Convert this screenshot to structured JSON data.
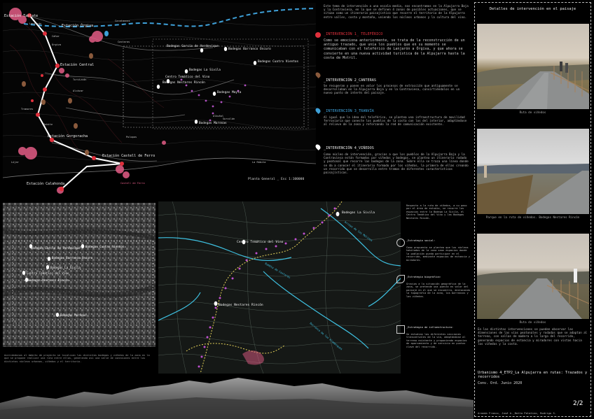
{
  "main_map": {
    "scale_label": "Planta General _ Esc 1:100000",
    "stations": [
      "Estación Tablate",
      "Estación Órgiva",
      "Estación Central",
      "Estación Gorgoracha",
      "Estación Castell de Ferro",
      "Estación Calahonda"
    ],
    "towns": [
      "Lanjarón",
      "Cáñar",
      "Órgiva",
      "Carataunas",
      "Castaras",
      "Torvizcón",
      "Alcázar",
      "Tramores",
      "Rubite",
      "Polopos",
      "Lújar",
      "La Rábita",
      "Castell de Ferro",
      "Sorvilán",
      "Albuñol"
    ],
    "wineries": [
      "Bodegas García de Verdevique",
      "Bodegas Barranco Oscuro",
      "Bodegas Cuatro Vientos",
      "Bodegas La Sivila",
      "Centro Temático del Vino",
      "Bodegas Nestares Rincón",
      "Bodegas Mayla",
      "Bodegas Marenas"
    ]
  },
  "center_text": {
    "intro": "Este tema de intervención a una escala media, nos encontramos en la Alpujarra Baja y la Contraviesa, en la que se definen 4 zonas de posibles actuaciones, que se sitúan como un itinerario paisajístico que recorre el territorio de la Alpujarra entre valles, costa y montaña, uniendo los núcleos urbanos y la cultura del vino.",
    "sections": [
      {
        "title": "_INTERVENCIÓN 1_ TELEFÉRICO",
        "color": "#e0303c",
        "icon": "red-dot",
        "text": "Como se emociona anteriormente, se trata de la reconstrucción de un antiguo trazado, que unía los pueblos que en su momento se comunicaban con el teleférico de Lanjarón a Órgiva, y que ahora se convierte en una nueva actividad turística de la Alpujarra hasta la costa de Motril."
      },
      {
        "title": "_INTERVENCIÓN 2_CANTERAS",
        "color": "#8a5a3c",
        "icon": "brown-pin",
        "text": "Se recuperan y ponen en valor los procesos de extracción que antiguamente se desarrollaban en la Alpujarra Baja y en la Contraviesa, convirtiéndolos en un nuevo punto de interés del paisaje."
      },
      {
        "title": "_INTERVENCIÓN 3_TRANVÍA",
        "color": "#3ea0d8",
        "icon": "blue-pin",
        "text": "Al igual que la idea del teleférico, se plantea una infraestructura de movilidad ferroviaria que conecte los pueblos de la costa con los del interior, adaptándose al relieve de la zona y reforzando la red de comunicación existente."
      },
      {
        "title": "_INTERVENCIÓN 4_VIÑEDOS",
        "color": "#ffffff",
        "icon": "white-pin",
        "text": "Como núcleo de intervención, gracias a que los pueblos de la Alpujarra Baja y la Contraviesa están formados por viñedos y bodegas, se plantea un itinerario rodado y peatonal que recorre las bodegas de la zona. Sobre ella se traza una línea donde se da a conocer el itinerario formado por los viñedos, la primera de ellas creando un recorrido que se desarrolla entre tramos de diferentes características paisajísticas."
      }
    ]
  },
  "right_panel": {
    "title": "Detalles de intervención en el paisaje",
    "captions": [
      "Ruta de viñedos",
      "Parque en la ruta de viñedos. Bodegas Nestares Rincón",
      "Ruta de viñedos"
    ],
    "footer_text": "En las distintas intervenciones se pueden observar las dimensiones de las vías peatonales y rodadas que se adaptan al terreno, con vallas de madera a lo largo del recorrido, generando espacios de estancia y miradores con vistas hacia los viñedos y la costa.",
    "project_title": "Urbanismo 4_ETP2_La Alpujarra en rutas: Trazados y recorridos",
    "convocatoria": "Conv. Ord. Junio 2020",
    "page": "2/2",
    "authors": "Aranda Franco, José A._Botta Palatino, Rodrigo S."
  },
  "bottom_left": {
    "caption": "Acercándonos al ámbito de proyecto se localizan las distintas bodegas y viñedos de la zona en la que se propone realizar una ruta entre ellas, generando así una serie de conexiones entre los distintos núcleos urbanos, viñedos y el territorio.",
    "wineries": [
      "Bodegas García de Verdevique",
      "Bodegas Cuatro Vientos",
      "Bodegas Barranco Oscuro",
      "Bodegas La Sivila",
      "Centro Temático del Vino",
      "Bodegas Nestares Rincón",
      "Bodegas Marenas"
    ]
  },
  "detail_map": {
    "labels": [
      "Bodegas La Sivila",
      "Centro Temático del Vino",
      "Bodegas Nestares Rincón",
      "Rambla de Castarás",
      "Arroyo de los Molinos",
      "Barranco de los Alambiques"
    ]
  },
  "strategies": {
    "intro": "Respecto a la ruta de viñedos, a su paso por el área de estudio, se recorre los espacios entre la Bodega La Sivila, el Centro Temático del Vino y las Bodegas Nestares Rincón.",
    "items": [
      {
        "title": "_Estrategia social:",
        "icon": "people-icon",
        "text": "Como propuesta se plantea que los núcleos habitados de la zona sean espacios donde la población pueda participar en el recorrido, mediante espacios de estancia y miradores."
      },
      {
        "title": "_Estrategia biográfica:",
        "icon": "leaf-icon",
        "text": "Gracias a la situación geográfica de la zona, se pretende una puesta en valor del paisaje en el que se encuentra, destacando la topografía de la zona, los barrancos y los viñedos."
      },
      {
        "title": "_Estrategia de infraestructura:",
        "icon": "road-icon",
        "text": "Se estudian las diferentes secciones transversales de la vía, adaptándose al terreno existente y proponiendo espacios de aparcamiento y de servicio en puntos clave del recorrido."
      }
    ]
  }
}
